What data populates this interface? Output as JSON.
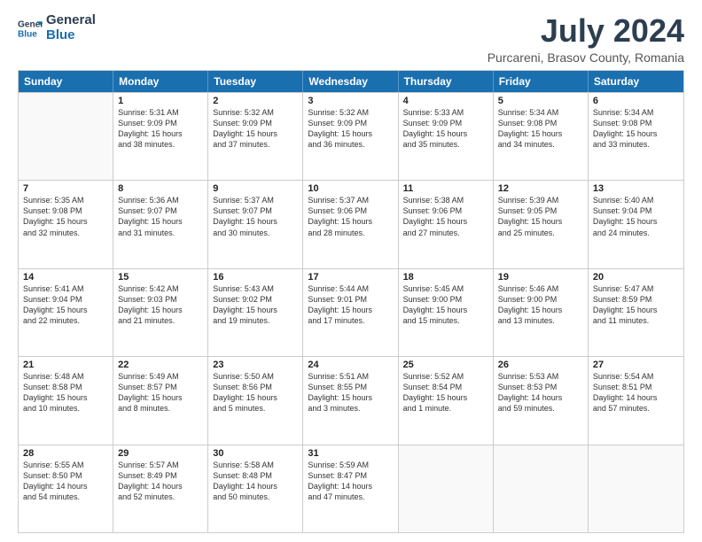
{
  "header": {
    "logo_line1": "General",
    "logo_line2": "Blue",
    "month": "July 2024",
    "location": "Purcareni, Brasov County, Romania"
  },
  "weekdays": [
    "Sunday",
    "Monday",
    "Tuesday",
    "Wednesday",
    "Thursday",
    "Friday",
    "Saturday"
  ],
  "weeks": [
    [
      {
        "day": "",
        "lines": []
      },
      {
        "day": "1",
        "lines": [
          "Sunrise: 5:31 AM",
          "Sunset: 9:09 PM",
          "Daylight: 15 hours",
          "and 38 minutes."
        ]
      },
      {
        "day": "2",
        "lines": [
          "Sunrise: 5:32 AM",
          "Sunset: 9:09 PM",
          "Daylight: 15 hours",
          "and 37 minutes."
        ]
      },
      {
        "day": "3",
        "lines": [
          "Sunrise: 5:32 AM",
          "Sunset: 9:09 PM",
          "Daylight: 15 hours",
          "and 36 minutes."
        ]
      },
      {
        "day": "4",
        "lines": [
          "Sunrise: 5:33 AM",
          "Sunset: 9:09 PM",
          "Daylight: 15 hours",
          "and 35 minutes."
        ]
      },
      {
        "day": "5",
        "lines": [
          "Sunrise: 5:34 AM",
          "Sunset: 9:08 PM",
          "Daylight: 15 hours",
          "and 34 minutes."
        ]
      },
      {
        "day": "6",
        "lines": [
          "Sunrise: 5:34 AM",
          "Sunset: 9:08 PM",
          "Daylight: 15 hours",
          "and 33 minutes."
        ]
      }
    ],
    [
      {
        "day": "7",
        "lines": [
          "Sunrise: 5:35 AM",
          "Sunset: 9:08 PM",
          "Daylight: 15 hours",
          "and 32 minutes."
        ]
      },
      {
        "day": "8",
        "lines": [
          "Sunrise: 5:36 AM",
          "Sunset: 9:07 PM",
          "Daylight: 15 hours",
          "and 31 minutes."
        ]
      },
      {
        "day": "9",
        "lines": [
          "Sunrise: 5:37 AM",
          "Sunset: 9:07 PM",
          "Daylight: 15 hours",
          "and 30 minutes."
        ]
      },
      {
        "day": "10",
        "lines": [
          "Sunrise: 5:37 AM",
          "Sunset: 9:06 PM",
          "Daylight: 15 hours",
          "and 28 minutes."
        ]
      },
      {
        "day": "11",
        "lines": [
          "Sunrise: 5:38 AM",
          "Sunset: 9:06 PM",
          "Daylight: 15 hours",
          "and 27 minutes."
        ]
      },
      {
        "day": "12",
        "lines": [
          "Sunrise: 5:39 AM",
          "Sunset: 9:05 PM",
          "Daylight: 15 hours",
          "and 25 minutes."
        ]
      },
      {
        "day": "13",
        "lines": [
          "Sunrise: 5:40 AM",
          "Sunset: 9:04 PM",
          "Daylight: 15 hours",
          "and 24 minutes."
        ]
      }
    ],
    [
      {
        "day": "14",
        "lines": [
          "Sunrise: 5:41 AM",
          "Sunset: 9:04 PM",
          "Daylight: 15 hours",
          "and 22 minutes."
        ]
      },
      {
        "day": "15",
        "lines": [
          "Sunrise: 5:42 AM",
          "Sunset: 9:03 PM",
          "Daylight: 15 hours",
          "and 21 minutes."
        ]
      },
      {
        "day": "16",
        "lines": [
          "Sunrise: 5:43 AM",
          "Sunset: 9:02 PM",
          "Daylight: 15 hours",
          "and 19 minutes."
        ]
      },
      {
        "day": "17",
        "lines": [
          "Sunrise: 5:44 AM",
          "Sunset: 9:01 PM",
          "Daylight: 15 hours",
          "and 17 minutes."
        ]
      },
      {
        "day": "18",
        "lines": [
          "Sunrise: 5:45 AM",
          "Sunset: 9:00 PM",
          "Daylight: 15 hours",
          "and 15 minutes."
        ]
      },
      {
        "day": "19",
        "lines": [
          "Sunrise: 5:46 AM",
          "Sunset: 9:00 PM",
          "Daylight: 15 hours",
          "and 13 minutes."
        ]
      },
      {
        "day": "20",
        "lines": [
          "Sunrise: 5:47 AM",
          "Sunset: 8:59 PM",
          "Daylight: 15 hours",
          "and 11 minutes."
        ]
      }
    ],
    [
      {
        "day": "21",
        "lines": [
          "Sunrise: 5:48 AM",
          "Sunset: 8:58 PM",
          "Daylight: 15 hours",
          "and 10 minutes."
        ]
      },
      {
        "day": "22",
        "lines": [
          "Sunrise: 5:49 AM",
          "Sunset: 8:57 PM",
          "Daylight: 15 hours",
          "and 8 minutes."
        ]
      },
      {
        "day": "23",
        "lines": [
          "Sunrise: 5:50 AM",
          "Sunset: 8:56 PM",
          "Daylight: 15 hours",
          "and 5 minutes."
        ]
      },
      {
        "day": "24",
        "lines": [
          "Sunrise: 5:51 AM",
          "Sunset: 8:55 PM",
          "Daylight: 15 hours",
          "and 3 minutes."
        ]
      },
      {
        "day": "25",
        "lines": [
          "Sunrise: 5:52 AM",
          "Sunset: 8:54 PM",
          "Daylight: 15 hours",
          "and 1 minute."
        ]
      },
      {
        "day": "26",
        "lines": [
          "Sunrise: 5:53 AM",
          "Sunset: 8:53 PM",
          "Daylight: 14 hours",
          "and 59 minutes."
        ]
      },
      {
        "day": "27",
        "lines": [
          "Sunrise: 5:54 AM",
          "Sunset: 8:51 PM",
          "Daylight: 14 hours",
          "and 57 minutes."
        ]
      }
    ],
    [
      {
        "day": "28",
        "lines": [
          "Sunrise: 5:55 AM",
          "Sunset: 8:50 PM",
          "Daylight: 14 hours",
          "and 54 minutes."
        ]
      },
      {
        "day": "29",
        "lines": [
          "Sunrise: 5:57 AM",
          "Sunset: 8:49 PM",
          "Daylight: 14 hours",
          "and 52 minutes."
        ]
      },
      {
        "day": "30",
        "lines": [
          "Sunrise: 5:58 AM",
          "Sunset: 8:48 PM",
          "Daylight: 14 hours",
          "and 50 minutes."
        ]
      },
      {
        "day": "31",
        "lines": [
          "Sunrise: 5:59 AM",
          "Sunset: 8:47 PM",
          "Daylight: 14 hours",
          "and 47 minutes."
        ]
      },
      {
        "day": "",
        "lines": []
      },
      {
        "day": "",
        "lines": []
      },
      {
        "day": "",
        "lines": []
      }
    ]
  ]
}
